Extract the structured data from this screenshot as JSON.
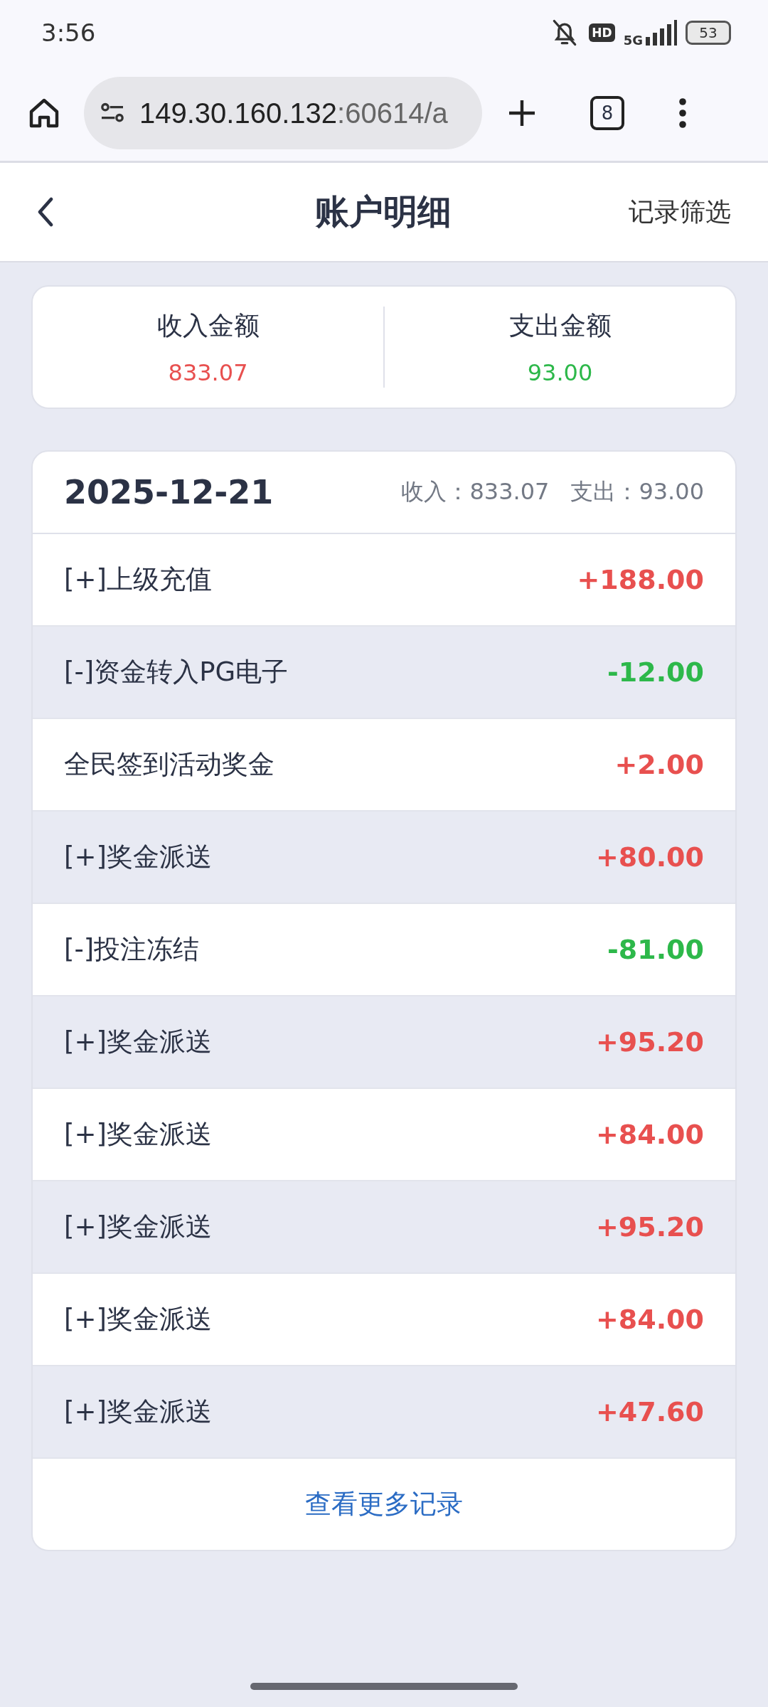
{
  "status_bar": {
    "time": "3:56",
    "hd": "HD",
    "network": "5G",
    "battery": "53"
  },
  "browser": {
    "url_host": "149.30.160.132",
    "url_rest": ":60614/a",
    "tab_count": "8"
  },
  "header": {
    "title": "账户明细",
    "action": "记录筛选"
  },
  "summary": [
    {
      "label": "收入金额",
      "value": "833.07",
      "kind": "income"
    },
    {
      "label": "支出金额",
      "value": "93.00",
      "kind": "expense"
    }
  ],
  "day": {
    "date": "2025-12-21",
    "income": "收入：833.07",
    "expense": "支出：93.00"
  },
  "records": [
    {
      "title": "[+]上级充值",
      "amount": "+188.00",
      "kind": "income"
    },
    {
      "title": "[-]资金转入PG电子",
      "amount": "-12.00",
      "kind": "expense"
    },
    {
      "title": "全民签到活动奖金",
      "amount": "+2.00",
      "kind": "income"
    },
    {
      "title": "[+]奖金派送",
      "amount": "+80.00",
      "kind": "income"
    },
    {
      "title": "[-]投注冻结",
      "amount": "-81.00",
      "kind": "expense"
    },
    {
      "title": "[+]奖金派送",
      "amount": "+95.20",
      "kind": "income"
    },
    {
      "title": "[+]奖金派送",
      "amount": "+84.00",
      "kind": "income"
    },
    {
      "title": "[+]奖金派送",
      "amount": "+95.20",
      "kind": "income"
    },
    {
      "title": "[+]奖金派送",
      "amount": "+84.00",
      "kind": "income"
    },
    {
      "title": "[+]奖金派送",
      "amount": "+47.60",
      "kind": "income"
    }
  ],
  "more_link": "查看更多记录"
}
